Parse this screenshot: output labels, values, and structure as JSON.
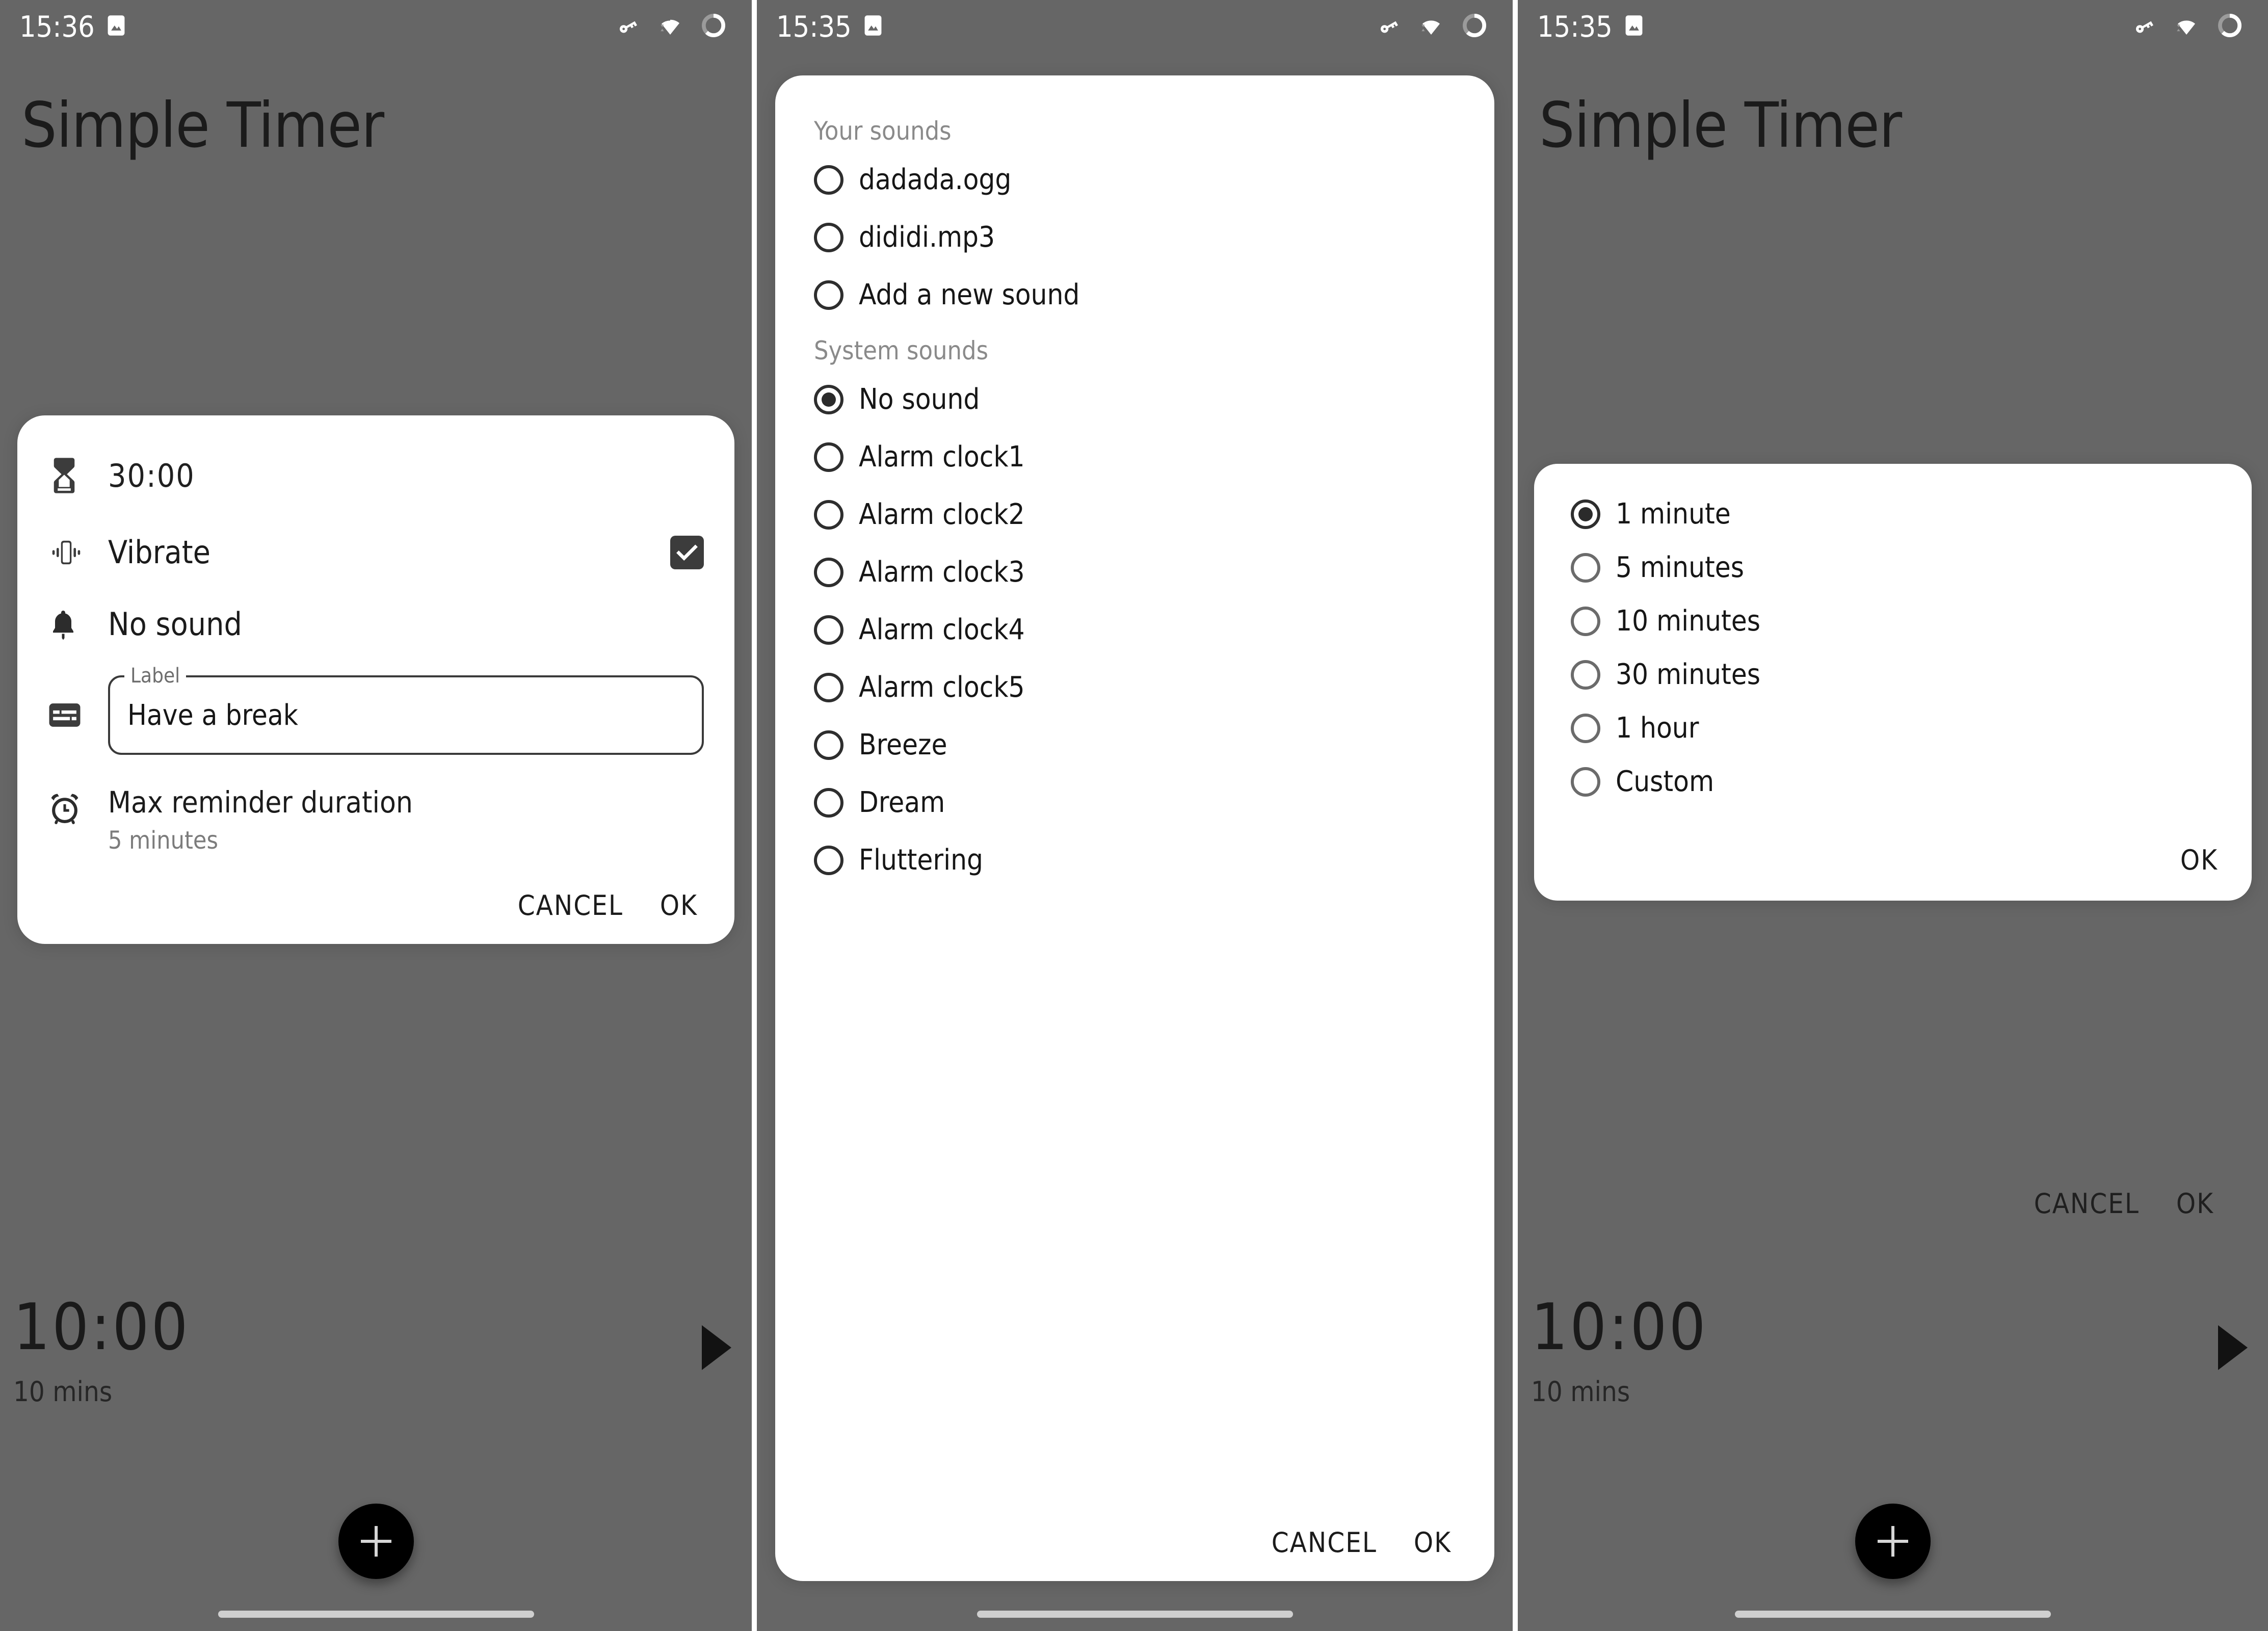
{
  "status_bar": {
    "time_panel1": "15:36",
    "time_panel2": "15:35",
    "time_panel3": "15:35",
    "icons": [
      "image-icon",
      "vpn-key-icon",
      "wifi-icon",
      "battery-circle-icon"
    ]
  },
  "app": {
    "title": "Simple Timer",
    "timer_time": "10:00",
    "timer_subtitle": "10 mins",
    "play_label": "play-icon",
    "fab_label": "+"
  },
  "edit_dialog": {
    "duration": "30:00",
    "vibrate_label": "Vibrate",
    "vibrate_checked": true,
    "sound_label": "No sound",
    "label_field": {
      "floating_label": "Label",
      "value": "Have a break",
      "placeholder": "Label"
    },
    "max_reminder": {
      "title": "Max reminder duration",
      "value": "5 minutes"
    },
    "cancel_label": "CANCEL",
    "ok_label": "OK"
  },
  "sound_dialog": {
    "your_sounds_header": "Your sounds",
    "your_sounds": [
      {
        "label": "dadada.ogg",
        "selected": false
      },
      {
        "label": "dididi.mp3",
        "selected": false
      },
      {
        "label": "Add a new sound",
        "selected": false
      }
    ],
    "system_sounds_header": "System sounds",
    "system_sounds": [
      {
        "label": "No sound",
        "selected": true
      },
      {
        "label": "Alarm clock1",
        "selected": false
      },
      {
        "label": "Alarm clock2",
        "selected": false
      },
      {
        "label": "Alarm clock3",
        "selected": false
      },
      {
        "label": "Alarm clock4",
        "selected": false
      },
      {
        "label": "Alarm clock5",
        "selected": false
      },
      {
        "label": "Breeze",
        "selected": false
      },
      {
        "label": "Dream",
        "selected": false
      },
      {
        "label": "Fluttering",
        "selected": false
      }
    ],
    "cancel_label": "CANCEL",
    "ok_label": "OK"
  },
  "maxdur_dialog": {
    "options": [
      {
        "label": "1 minute",
        "selected": true
      },
      {
        "label": "5 minutes",
        "selected": false
      },
      {
        "label": "10 minutes",
        "selected": false
      },
      {
        "label": "30 minutes",
        "selected": false
      },
      {
        "label": "1 hour",
        "selected": false
      },
      {
        "label": "Custom",
        "selected": false
      }
    ],
    "ok_label": "OK",
    "behind_cancel_label": "CANCEL",
    "behind_ok_label": "OK"
  },
  "colors": {
    "scrim": "#666666",
    "surface": "#ffffff",
    "on_surface": "#1b1b1b",
    "muted": "#8a8a8a",
    "accent_dark": "#000000"
  }
}
